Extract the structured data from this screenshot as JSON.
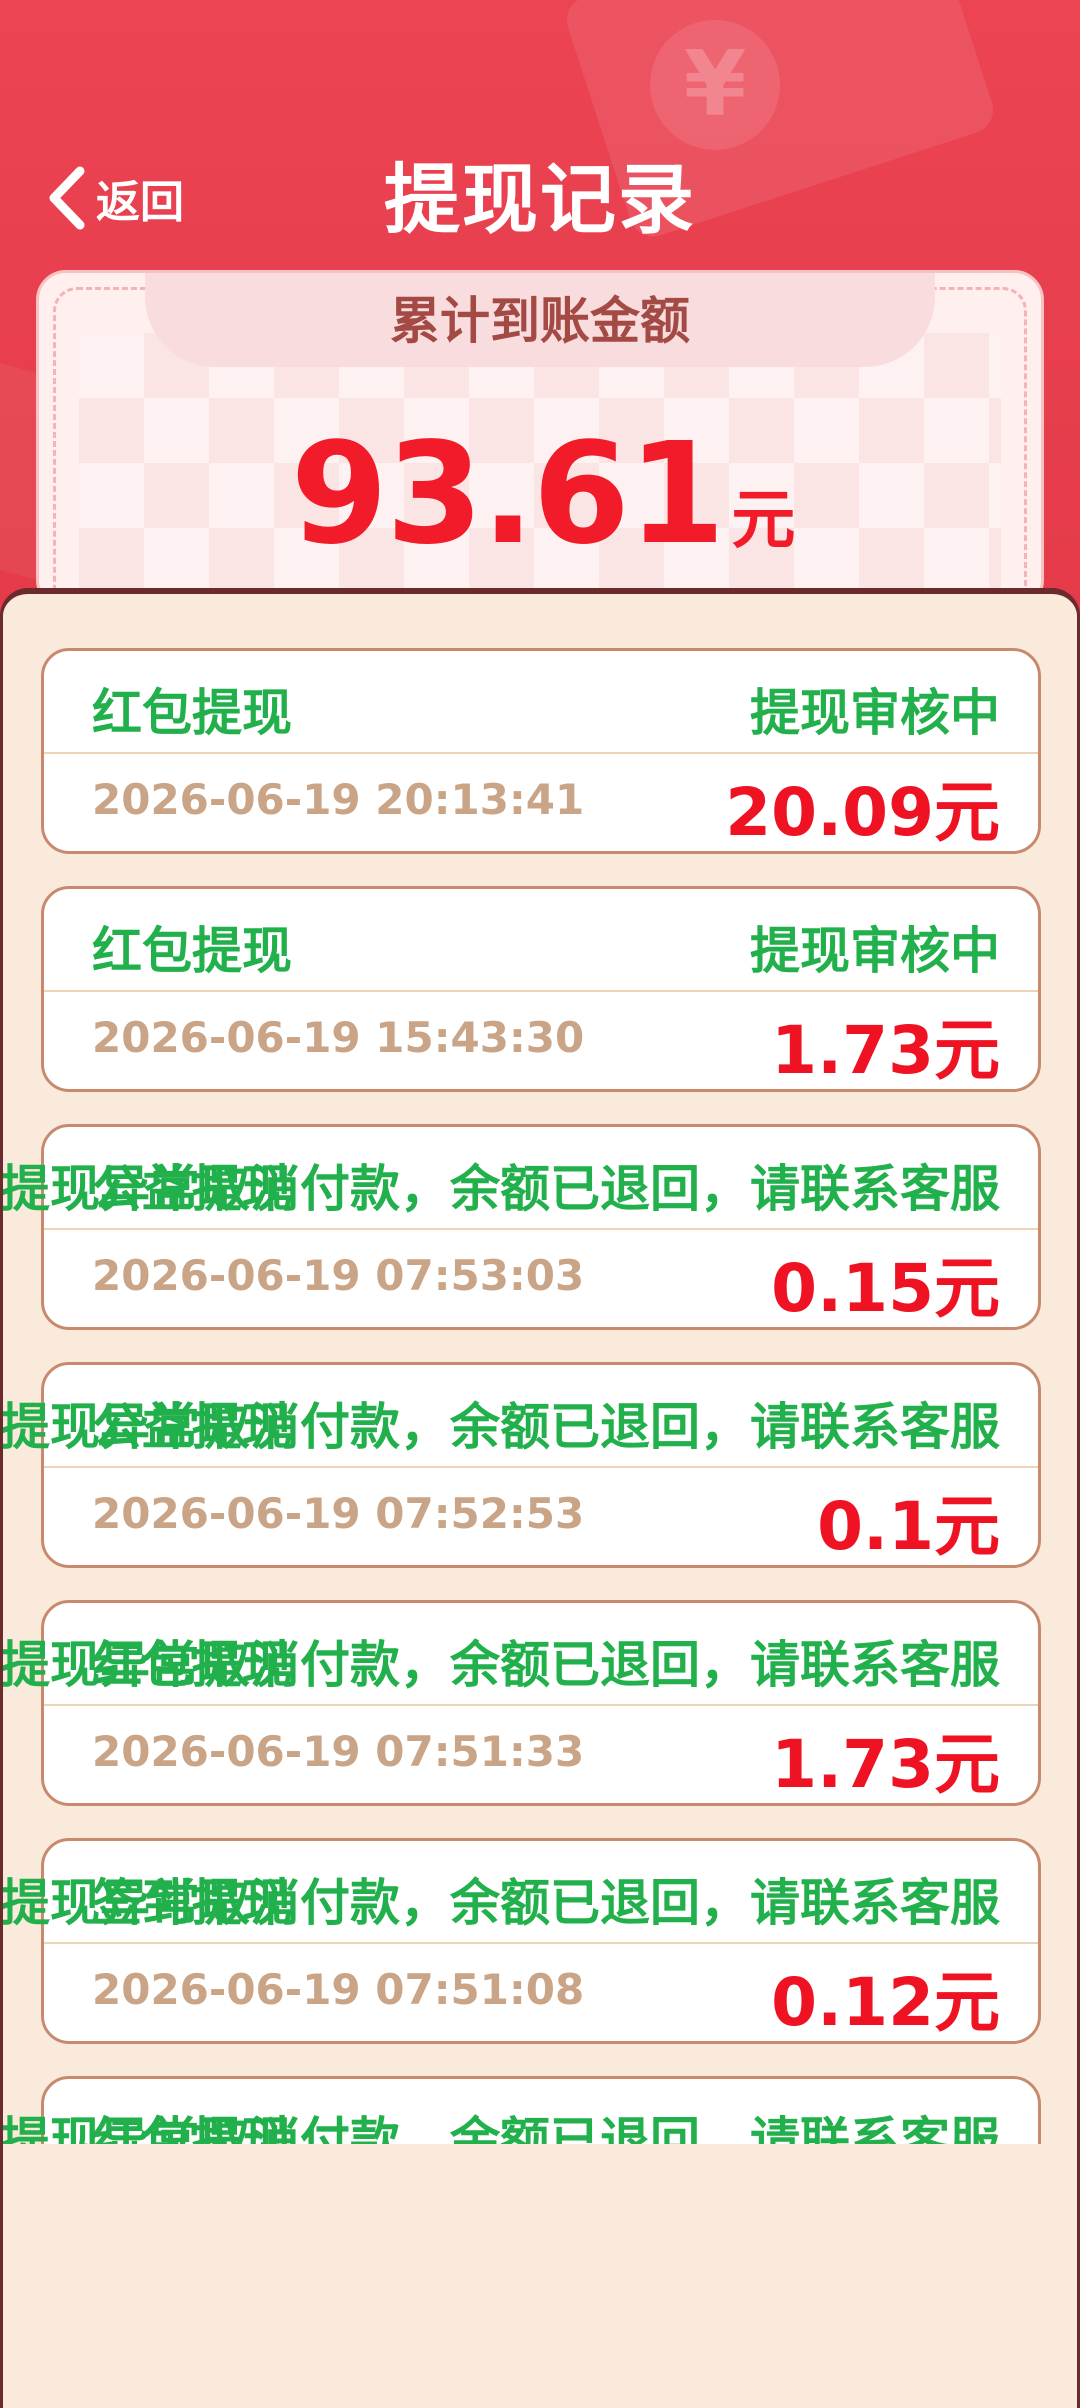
{
  "nav": {
    "back_label": "返回",
    "title": "提现记录"
  },
  "summary": {
    "label": "累计到账金额",
    "amount": "93.61",
    "unit": "元"
  },
  "colors": {
    "header": "#e8414f",
    "status_green": "#21b04b",
    "amount_red": "#ee1223",
    "panel_bg": "#faeadb"
  },
  "records": [
    {
      "type": "红包提现",
      "status": "提现审核中",
      "date": "2026-06-19 20:13:41",
      "amount": "20.09元"
    },
    {
      "type": "红包提现",
      "status": "提现审核中",
      "date": "2026-06-19 15:43:30",
      "amount": "1.73元"
    },
    {
      "type": "公益提现",
      "status": "提现异常取消付款，余额已退回，请联系客服",
      "date": "2026-06-19 07:53:03",
      "amount": "0.15元"
    },
    {
      "type": "公益提现",
      "status": "提现异常取消付款，余额已退回，请联系客服",
      "date": "2026-06-19 07:52:53",
      "amount": "0.1元"
    },
    {
      "type": "红包提现",
      "status": "提现异常取消付款，余额已退回，请联系客服",
      "date": "2026-06-19 07:51:33",
      "amount": "1.73元"
    },
    {
      "type": "签到提现",
      "status": "提现异常取消付款，余额已退回，请联系客服",
      "date": "2026-06-19 07:51:08",
      "amount": "0.12元"
    },
    {
      "type": "红包提现",
      "status": "提现异常取消付款，余额已退回，请联系客服",
      "date": "",
      "amount": ""
    }
  ]
}
